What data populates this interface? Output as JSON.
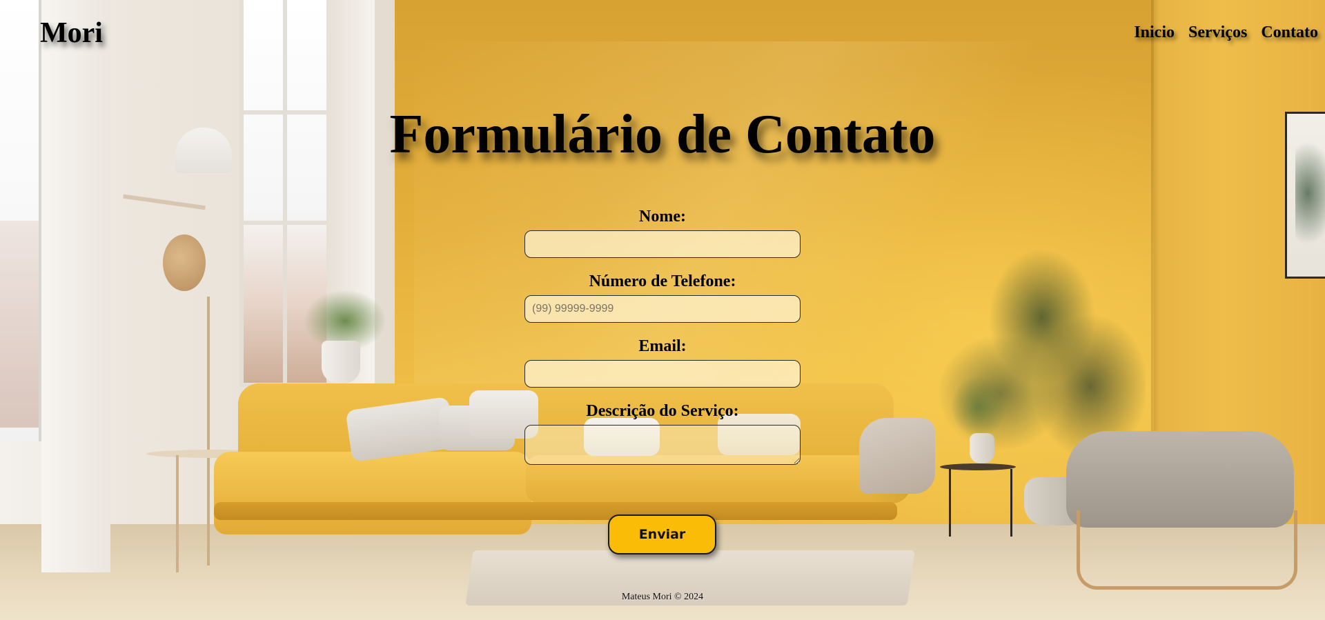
{
  "header": {
    "logo": "Mori",
    "nav": [
      {
        "label": "Inicio"
      },
      {
        "label": "Serviços"
      },
      {
        "label": "Contato"
      }
    ]
  },
  "main": {
    "title": "Formulário de Contato",
    "form": {
      "name_label": "Nome:",
      "name_value": "",
      "phone_label": "Número de Telefone:",
      "phone_placeholder": "(99) 99999-9999",
      "phone_value": "",
      "email_label": "Email:",
      "email_value": "",
      "description_label": "Descrição do Serviço:",
      "description_value": "",
      "submit_label": "Enviar"
    }
  },
  "footer": {
    "text": "Mateus Mori © 2024"
  },
  "colors": {
    "accent_button": "#fbbc08",
    "wall_yellow": "#e9b540",
    "input_background": "#fff6da"
  }
}
